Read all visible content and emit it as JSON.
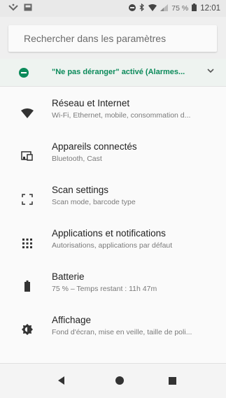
{
  "status_bar": {
    "battery_percent": "75 %",
    "time": "12:01"
  },
  "search": {
    "placeholder": "Rechercher dans les paramètres"
  },
  "dnd_banner": {
    "text": "\"Ne pas déranger\" activé (Alarmes..."
  },
  "settings": [
    {
      "icon": "wifi-icon",
      "title": "Réseau et Internet",
      "subtitle": "Wi-Fi, Ethernet, mobile, consommation d..."
    },
    {
      "icon": "devices-icon",
      "title": "Appareils connectés",
      "subtitle": "Bluetooth, Cast"
    },
    {
      "icon": "scan-icon",
      "title": "Scan settings",
      "subtitle": "Scan mode, barcode type"
    },
    {
      "icon": "apps-grid-icon",
      "title": "Applications et notifications",
      "subtitle": "Autorisations, applications par défaut"
    },
    {
      "icon": "battery-icon",
      "title": "Batterie",
      "subtitle": "75 % – Temps restant : 11h 47m"
    },
    {
      "icon": "brightness-icon",
      "title": "Affichage",
      "subtitle": "Fond d'écran, mise en veille, taille de poli..."
    }
  ],
  "colors": {
    "accent": "#0b8a5a",
    "icon": "#333333"
  }
}
